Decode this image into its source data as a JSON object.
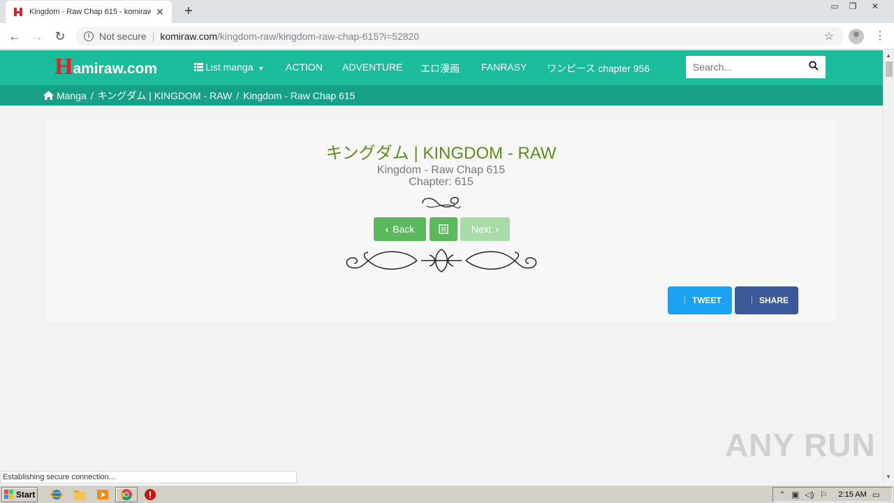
{
  "browser": {
    "tab_title": "Kingdom - Raw Chap 615 - komiraw.c",
    "tab_close": "✕",
    "new_tab": "+",
    "security_label": "Not secure",
    "url_host": "komiraw.com",
    "url_path": "/kingdom-raw/kingdom-raw-chap-615?i=52820",
    "status_text": "Establishing secure connection..."
  },
  "site": {
    "logo_h": "H",
    "logo_rest": "amiraw.com",
    "menu": {
      "list_manga": "List manga",
      "action": "ACTION",
      "adventure": "ADVENTURE",
      "ero": "エロ漫画",
      "fanrasy": "FANRASY",
      "onepiece": "ワンピース chapter 956"
    },
    "search_placeholder": "Search...",
    "breadcrumb": [
      "Manga",
      "キングダム | KINGDOM - RAW",
      "Kingdom - Raw Chap 615"
    ],
    "breadcrumb_sep": "/"
  },
  "chapter": {
    "manga_title": "キングダム | KINGDOM - RAW",
    "chapter_name": "Kingdom - Raw Chap 615",
    "chapter_number": "Chapter: 615",
    "back_label": "Back",
    "next_label": "Next",
    "tweet_label": "TWEET",
    "share_label": "SHARE"
  },
  "colors": {
    "header": "#1abc9c",
    "breadcrumb_bar": "#16a085",
    "title_green": "#5b8f1a",
    "button_green": "#5cb85c",
    "twitter": "#1da1f2",
    "facebook": "#3b5998"
  },
  "taskbar": {
    "start_label": "Start",
    "clock": "2:15 AM"
  },
  "watermark": "ANY RUN"
}
